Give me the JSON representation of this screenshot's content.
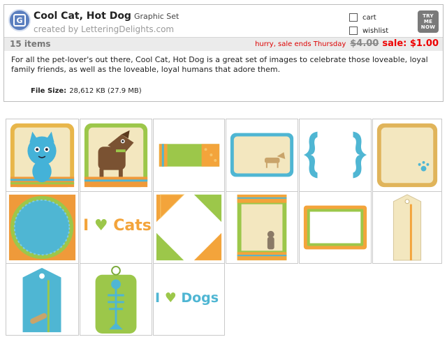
{
  "product": {
    "title": "Cool Cat, Hot Dog",
    "type": "Graphic Set",
    "byline": "created by LetteringDelights.com",
    "logo_letter": "G",
    "icon": "product-logo-icon"
  },
  "actions": {
    "cart_label": "cart",
    "wishlist_label": "wishlist",
    "try_me_now": "TRY ME NOW"
  },
  "info": {
    "items": "15 items",
    "hurry": "hurry, sale ends Thursday",
    "old_price": "$4.00",
    "sale_price": "sale: $1.00"
  },
  "description": "For all the pet-lover's out there, Cool Cat, Hot Dog is a great set of images to celebrate those loveable, loyal family friends, as well as the loveable, loyal humans that adore them.",
  "file_size": {
    "label": "File Size:",
    "value": "28,612 KB (27.9 MB)"
  },
  "grid": {
    "thumbnails": [
      {
        "name": "blue-cat-frame"
      },
      {
        "name": "brown-dog-frame"
      },
      {
        "name": "striped-banner"
      },
      {
        "name": "dog-frame-card"
      },
      {
        "name": "blue-brackets"
      },
      {
        "name": "paw-frame"
      },
      {
        "name": "blue-circle-frame"
      },
      {
        "name": "i-love-cats-word",
        "text": "I ♥ Cats"
      },
      {
        "name": "photo-corners"
      },
      {
        "name": "cat-stripe-frame"
      },
      {
        "name": "orange-rect-frame"
      },
      {
        "name": "cream-tag"
      },
      {
        "name": "blue-bone-tag"
      },
      {
        "name": "green-fishbone-tag"
      },
      {
        "name": "i-love-dogs-word",
        "text": "I ♥ Dogs"
      }
    ]
  },
  "colors": {
    "sale_red": "#e00000",
    "blue": "#4fb6d3",
    "orange": "#f3a43b",
    "green": "#9cc74a",
    "cream": "#f0e7c8"
  }
}
